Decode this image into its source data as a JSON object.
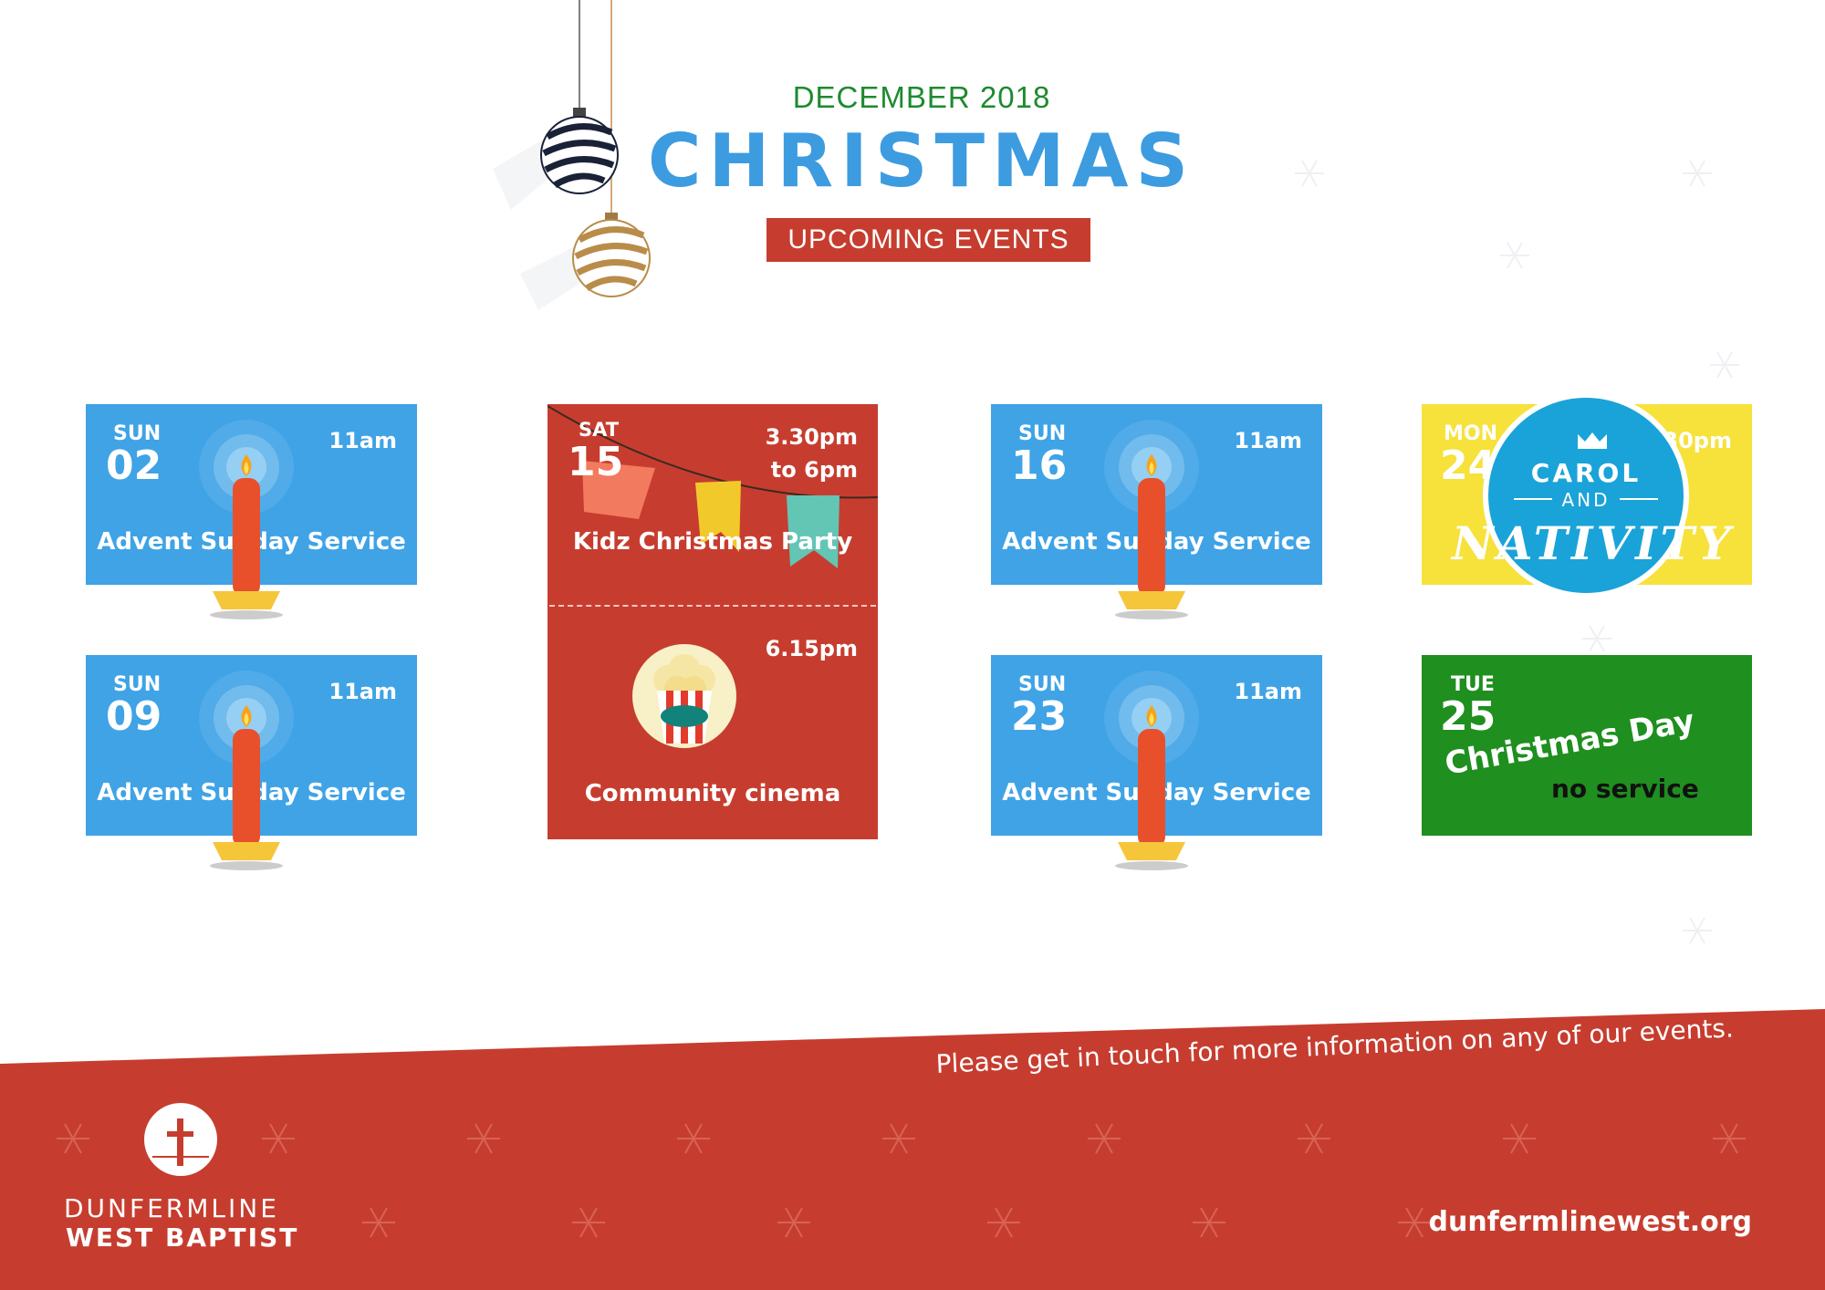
{
  "header": {
    "month_year": "DECEMBER 2018",
    "title": "CHRISTMAS",
    "tagline": "UPCOMING EVENTS"
  },
  "events": {
    "sun02": {
      "day": "SUN",
      "date": "02",
      "time": "11am",
      "name": "Advent Sunday Service"
    },
    "sun09": {
      "day": "SUN",
      "date": "09",
      "time": "11am",
      "name": "Advent Sunday Service"
    },
    "sat15": {
      "day": "SAT",
      "date": "15",
      "time_line1": "3.30pm",
      "time_line2": "to 6pm",
      "name": "Kidz Christmas Party",
      "second_time": "6.15pm",
      "second_name": "Community cinema"
    },
    "sun16": {
      "day": "SUN",
      "date": "16",
      "time": "11am",
      "name": "Advent Sunday Service"
    },
    "sun23": {
      "day": "SUN",
      "date": "23",
      "time": "11am",
      "name": "Advent Sunday Service"
    },
    "mon24": {
      "day": "MON",
      "date": "24",
      "time": "5.30pm",
      "badge_line1": "CAROL",
      "badge_line2": "AND",
      "badge_line3": "NATIVITY"
    },
    "tue25": {
      "day": "TUE",
      "date": "25",
      "name": "Christmas Day",
      "note": "no service"
    }
  },
  "footer": {
    "message": "Please get in touch for more information on any of our events.",
    "url": "dunfermlinewest.org",
    "org_line1": "DUNFERMLINE",
    "org_line2": "WEST BAPTIST"
  },
  "colors": {
    "blue": "#3fa3e6",
    "red": "#c63d2f",
    "yellow": "#f7e13b",
    "green": "#1f8f1f",
    "title_blue": "#3d9be0",
    "subtitle_green": "#1e8a2e"
  }
}
